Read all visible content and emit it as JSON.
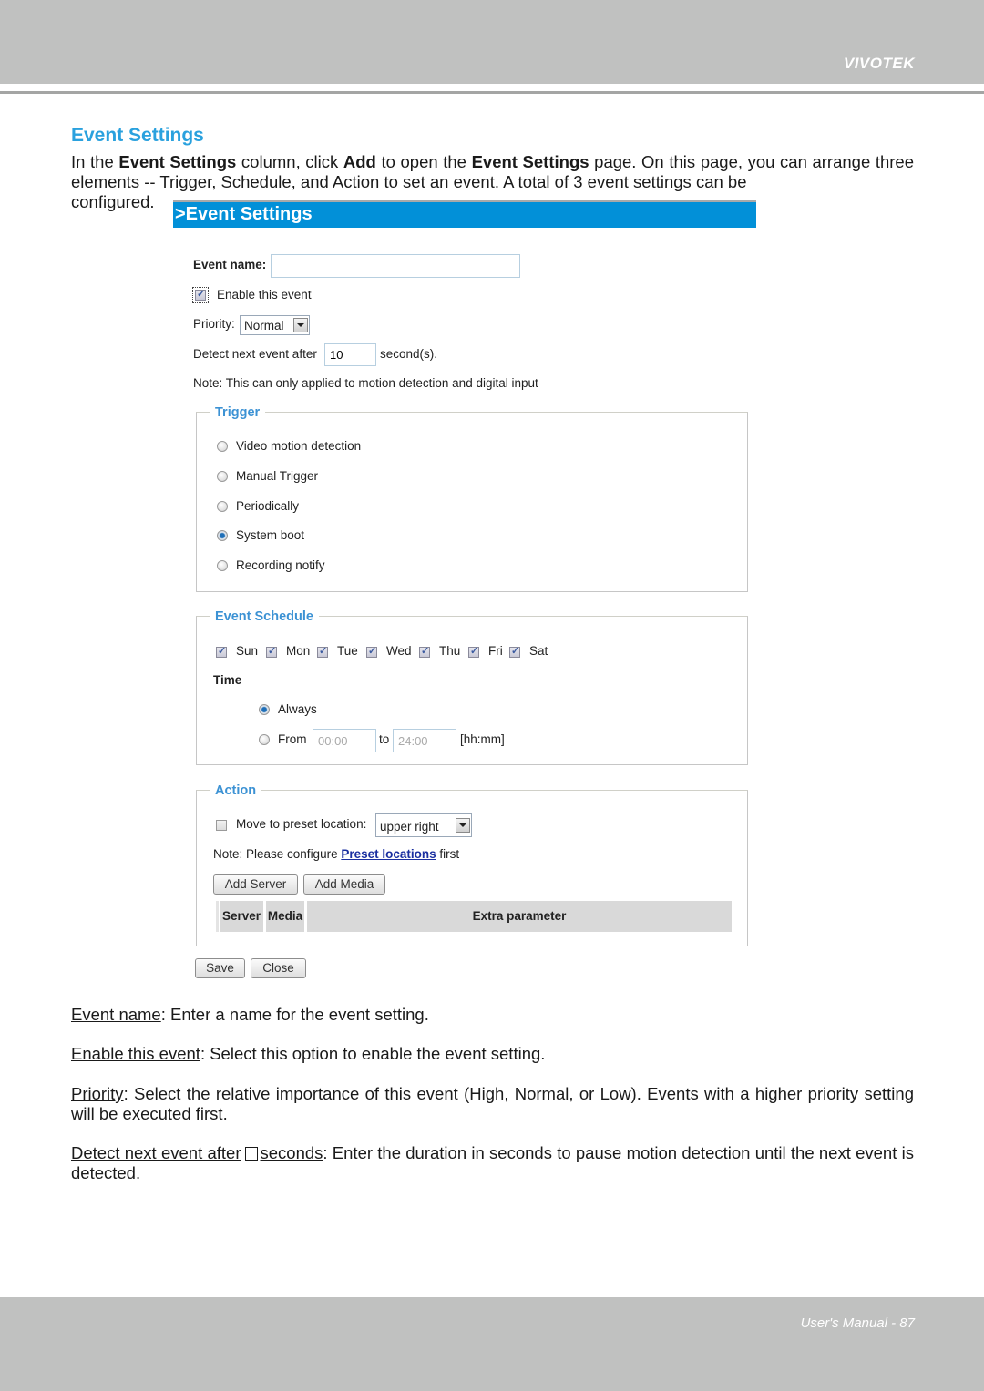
{
  "header": {
    "brand": "VIVOTEK"
  },
  "section": {
    "title": "Event Settings",
    "intro_parts": [
      "In the ",
      "Event Settings",
      " column, click ",
      "Add",
      " to open the ",
      "Event Settings",
      " page. On this page, you can arrange three elements -- Trigger, Schedule, and Action to set an event. A total of 3 event settings can be"
    ],
    "intro_tail": "configured."
  },
  "screenshot": {
    "title": ">Event Settings",
    "event_name": {
      "label": "Event name:",
      "value": ""
    },
    "enable": {
      "label": "Enable this event",
      "checked": true
    },
    "priority": {
      "label": "Priority:",
      "selected": "Normal"
    },
    "detect": {
      "label": "Detect next event after",
      "value": "10",
      "unit": "second(s)."
    },
    "note": "Note: This can only applied to motion detection and digital input",
    "trigger": {
      "legend": "Trigger",
      "options": [
        {
          "label": "Video motion detection",
          "selected": false
        },
        {
          "label": "Manual Trigger",
          "selected": false
        },
        {
          "label": "Periodically",
          "selected": false
        },
        {
          "label": "System boot",
          "selected": true
        },
        {
          "label": "Recording notify",
          "selected": false
        }
      ]
    },
    "schedule": {
      "legend": "Event Schedule",
      "days": [
        {
          "label": "Sun",
          "checked": true
        },
        {
          "label": "Mon",
          "checked": true
        },
        {
          "label": "Tue",
          "checked": true
        },
        {
          "label": "Wed",
          "checked": true
        },
        {
          "label": "Thu",
          "checked": true
        },
        {
          "label": "Fri",
          "checked": true
        },
        {
          "label": "Sat",
          "checked": true
        }
      ],
      "time_label": "Time",
      "always_label": "Always",
      "from_label": "From",
      "from_value": "00:00",
      "to_label": "to",
      "to_value": "24:00",
      "format": "[hh:mm]"
    },
    "action": {
      "legend": "Action",
      "preset_label": "Move to preset location:",
      "preset_checked": false,
      "preset_selected": "upper right",
      "note_prefix": "Note: Please configure ",
      "note_link": "Preset locations",
      "note_suffix": " first",
      "add_server": "Add Server",
      "add_media": "Add Media",
      "columns": [
        "Server",
        "Media",
        "Extra parameter"
      ]
    },
    "save": "Save",
    "close": "Close"
  },
  "descriptions": [
    {
      "term": "Event name",
      "text": ": Enter a name for the event setting."
    },
    {
      "term": "Enable this event",
      "text": ": Select this option to enable the event setting."
    },
    {
      "term": "Priority",
      "text": ": Select the relative importance of this event (High, Normal, or Low). Events with a higher priority setting will be executed first."
    },
    {
      "term_a": "Detect next event after",
      "term_b": "seconds",
      "text": ": Enter the duration in seconds to pause motion detection until the next event is detected."
    }
  ],
  "footer": {
    "page_label": "User's Manual - 87"
  }
}
